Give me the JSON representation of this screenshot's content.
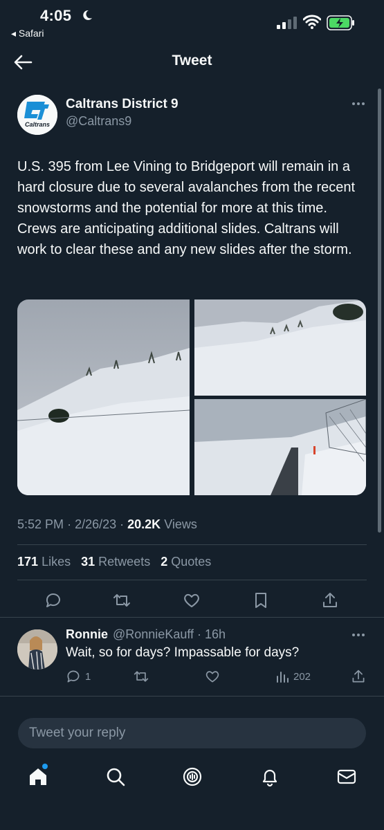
{
  "status_bar": {
    "time": "4:05",
    "back_app": "◂ Safari"
  },
  "header": {
    "title": "Tweet"
  },
  "tweet": {
    "author_name": "Caltrans District 9",
    "author_handle": "@Caltrans9",
    "logo_text": "Caltrans",
    "text": "U.S. 395 from Lee Vining to Bridgeport will remain in a hard closure due to several avalanches from the recent snowstorms and the potential for more at this time. Crews are anticipating additional slides. Caltrans will work to clear these and any new slides after the storm.",
    "time": "5:52 PM",
    "date": "2/26/23",
    "views": "20.2K",
    "views_label": "Views",
    "likes": "171",
    "likes_label": "Likes",
    "retweets": "31",
    "retweets_label": "Retweets",
    "quotes": "2",
    "quotes_label": "Quotes"
  },
  "reply": {
    "name": "Ronnie",
    "handle": "@RonnieKauff · 16h",
    "text": "Wait, so for days? Impassable for days?",
    "reply_count": "1",
    "views": "202"
  },
  "composer": {
    "placeholder": "Tweet your reply"
  },
  "icons": {
    "back": "arrow-left-icon",
    "more": "more-horizontal-icon",
    "reply": "comment-icon",
    "retweet": "retweet-icon",
    "like": "heart-icon",
    "bookmark": "bookmark-icon",
    "share": "share-icon",
    "views": "bar-chart-icon",
    "tabs": [
      "home-icon",
      "search-icon",
      "spaces-icon",
      "bell-icon",
      "mail-icon"
    ]
  },
  "colors": {
    "background": "#15202b",
    "accent": "#1d9bf0",
    "muted": "#8b98a5",
    "divider": "#38444d"
  }
}
